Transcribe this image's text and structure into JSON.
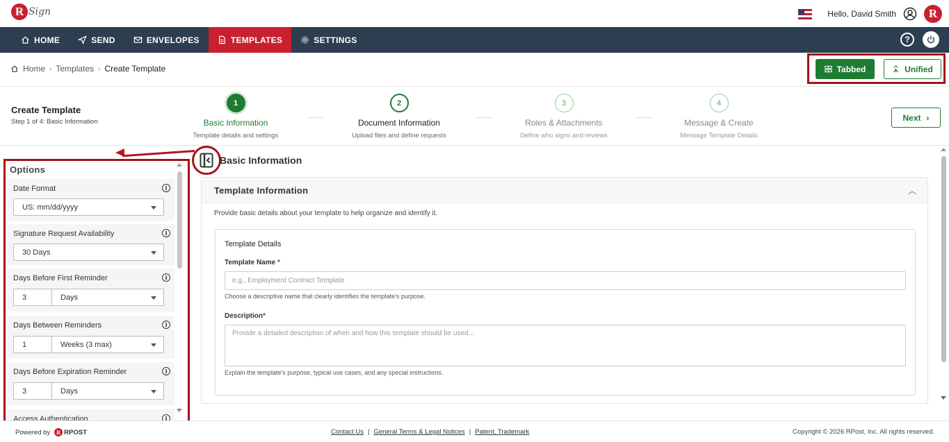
{
  "header": {
    "logo_sign": "Sign",
    "greeting": "Hello, David Smith",
    "avatar_letter": "R"
  },
  "nav": {
    "items": [
      {
        "label": "HOME",
        "icon": "home-icon"
      },
      {
        "label": "SEND",
        "icon": "send-icon"
      },
      {
        "label": "ENVELOPES",
        "icon": "envelope-icon"
      },
      {
        "label": "TEMPLATES",
        "icon": "document-icon",
        "active": true
      },
      {
        "label": "SETTINGS",
        "icon": "gear-icon"
      }
    ],
    "help_label": "?"
  },
  "breadcrumb": {
    "items": [
      "Home",
      "Templates",
      "Create Template"
    ]
  },
  "view_toggle": {
    "tabbed": "Tabbed",
    "unified": "Unified"
  },
  "page": {
    "title": "Create Template",
    "subtitle": "Step 1 of 4: Basic Information",
    "next": "Next"
  },
  "steps": [
    {
      "num": "1",
      "label": "Basic Information",
      "desc": "Template details and settings"
    },
    {
      "num": "2",
      "label": "Document Information",
      "desc": "Upload files and define requests"
    },
    {
      "num": "3",
      "label": "Roles & Attachments",
      "desc": "Define who signs and reviews"
    },
    {
      "num": "4",
      "label": "Message & Create",
      "desc": "Message Template Details"
    }
  ],
  "options": {
    "title": "Options",
    "date_format": {
      "label": "Date Format",
      "value": "US: mm/dd/yyyy"
    },
    "availability": {
      "label": "Signature Request Availability",
      "value": "30 Days"
    },
    "first_reminder": {
      "label": "Days Before First Reminder",
      "num": "3",
      "unit": "Days"
    },
    "between_reminders": {
      "label": "Days Between Reminders",
      "num": "1",
      "unit": "Weeks (3 max)"
    },
    "expiration_reminder": {
      "label": "Days Before Expiration Reminder",
      "num": "3",
      "unit": "Days"
    },
    "next_label": "Access Authentication"
  },
  "main": {
    "section_title": "Basic Information",
    "card_title": "Template Information",
    "card_desc": "Provide basic details about your template to help organize and identify it.",
    "details_title": "Template Details",
    "name_label": "Template Name",
    "name_placeholder": "e.g., Employment Contract Template",
    "name_hint": "Choose a descriptive name that clearly identifies the template's purpose.",
    "desc_label": "Description",
    "desc_placeholder": "Provide a detailed description of when and how this template should be used...",
    "desc_hint": "Explain the template's purpose, typical use cases, and any special instructions.",
    "required_mark": "*"
  },
  "footer": {
    "powered_by": "Powered by",
    "brand": "RPOST",
    "links": [
      "Contact Us",
      "General Terms & Legal Notices",
      "Patent, Trademark"
    ],
    "copyright": "Copyright © 2026 RPost, Inc. All rights reserved."
  },
  "colors": {
    "brand_red": "#c8202f",
    "nav_bg": "#2c3e50",
    "accent_green": "#1e7b34",
    "annotation_red": "#a51219"
  }
}
